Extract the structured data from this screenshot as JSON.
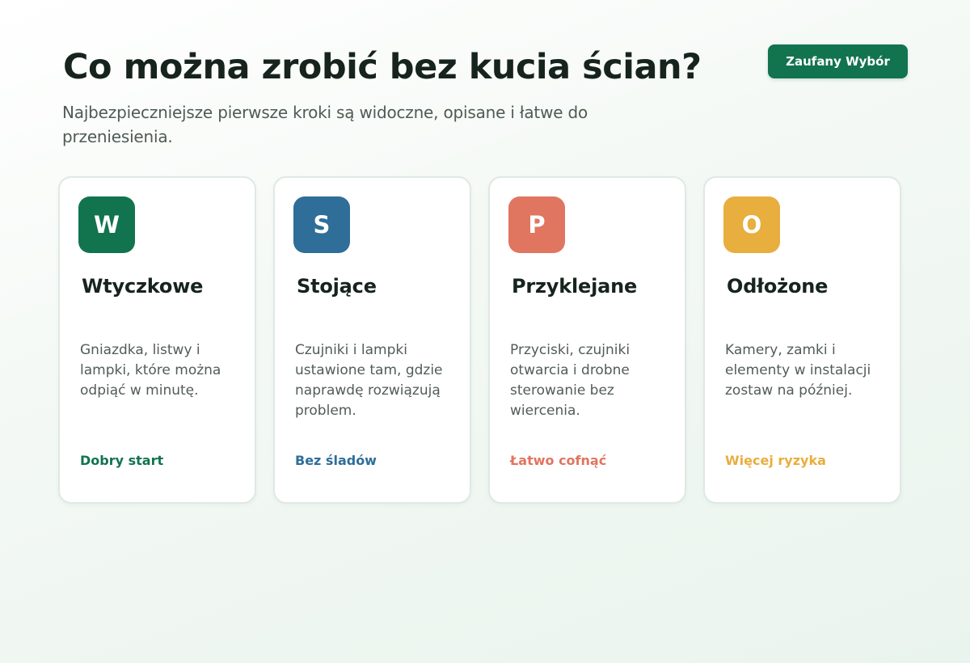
{
  "header": {
    "title": "Co można zrobić bez kucia ścian?",
    "subtitle": "Najbezpieczniejsze pierwsze kroki są widoczne, opisane i łatwe do przeniesienia.",
    "badge": "Zaufany Wybór"
  },
  "colors": {
    "green": "#12734f",
    "blue": "#2e6e99",
    "coral": "#e07560",
    "amber": "#e8ae3e"
  },
  "cards": [
    {
      "letter": "W",
      "title": "Wtyczkowe",
      "description": "Gniazdka, listwy i lampki, które można odpiąć w minutę.",
      "tag": "Dobry start",
      "color": "#12734f"
    },
    {
      "letter": "S",
      "title": "Stojące",
      "description": "Czujniki i lampki ustawione tam, gdzie naprawdę rozwiązują problem.",
      "tag": "Bez śladów",
      "color": "#2e6e99"
    },
    {
      "letter": "P",
      "title": "Przyklejane",
      "description": "Przyciski, czujniki otwarcia i drobne sterowanie bez wiercenia.",
      "tag": "Łatwo cofnąć",
      "color": "#e07560"
    },
    {
      "letter": "O",
      "title": "Odłożone",
      "description": "Kamery, zamki i elementy w instalacji zostaw na później.",
      "tag": "Więcej ryzyka",
      "color": "#e8ae3e"
    }
  ]
}
